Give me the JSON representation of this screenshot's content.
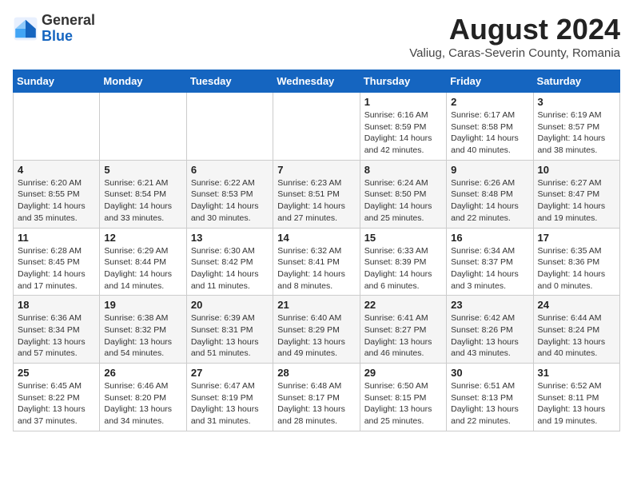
{
  "header": {
    "logo_general": "General",
    "logo_blue": "Blue",
    "title": "August 2024",
    "subtitle": "Valiug, Caras-Severin County, Romania"
  },
  "weekdays": [
    "Sunday",
    "Monday",
    "Tuesday",
    "Wednesday",
    "Thursday",
    "Friday",
    "Saturday"
  ],
  "weeks": [
    [
      {
        "day": "",
        "info": ""
      },
      {
        "day": "",
        "info": ""
      },
      {
        "day": "",
        "info": ""
      },
      {
        "day": "",
        "info": ""
      },
      {
        "day": "1",
        "info": "Sunrise: 6:16 AM\nSunset: 8:59 PM\nDaylight: 14 hours and 42 minutes."
      },
      {
        "day": "2",
        "info": "Sunrise: 6:17 AM\nSunset: 8:58 PM\nDaylight: 14 hours and 40 minutes."
      },
      {
        "day": "3",
        "info": "Sunrise: 6:19 AM\nSunset: 8:57 PM\nDaylight: 14 hours and 38 minutes."
      }
    ],
    [
      {
        "day": "4",
        "info": "Sunrise: 6:20 AM\nSunset: 8:55 PM\nDaylight: 14 hours and 35 minutes."
      },
      {
        "day": "5",
        "info": "Sunrise: 6:21 AM\nSunset: 8:54 PM\nDaylight: 14 hours and 33 minutes."
      },
      {
        "day": "6",
        "info": "Sunrise: 6:22 AM\nSunset: 8:53 PM\nDaylight: 14 hours and 30 minutes."
      },
      {
        "day": "7",
        "info": "Sunrise: 6:23 AM\nSunset: 8:51 PM\nDaylight: 14 hours and 27 minutes."
      },
      {
        "day": "8",
        "info": "Sunrise: 6:24 AM\nSunset: 8:50 PM\nDaylight: 14 hours and 25 minutes."
      },
      {
        "day": "9",
        "info": "Sunrise: 6:26 AM\nSunset: 8:48 PM\nDaylight: 14 hours and 22 minutes."
      },
      {
        "day": "10",
        "info": "Sunrise: 6:27 AM\nSunset: 8:47 PM\nDaylight: 14 hours and 19 minutes."
      }
    ],
    [
      {
        "day": "11",
        "info": "Sunrise: 6:28 AM\nSunset: 8:45 PM\nDaylight: 14 hours and 17 minutes."
      },
      {
        "day": "12",
        "info": "Sunrise: 6:29 AM\nSunset: 8:44 PM\nDaylight: 14 hours and 14 minutes."
      },
      {
        "day": "13",
        "info": "Sunrise: 6:30 AM\nSunset: 8:42 PM\nDaylight: 14 hours and 11 minutes."
      },
      {
        "day": "14",
        "info": "Sunrise: 6:32 AM\nSunset: 8:41 PM\nDaylight: 14 hours and 8 minutes."
      },
      {
        "day": "15",
        "info": "Sunrise: 6:33 AM\nSunset: 8:39 PM\nDaylight: 14 hours and 6 minutes."
      },
      {
        "day": "16",
        "info": "Sunrise: 6:34 AM\nSunset: 8:37 PM\nDaylight: 14 hours and 3 minutes."
      },
      {
        "day": "17",
        "info": "Sunrise: 6:35 AM\nSunset: 8:36 PM\nDaylight: 14 hours and 0 minutes."
      }
    ],
    [
      {
        "day": "18",
        "info": "Sunrise: 6:36 AM\nSunset: 8:34 PM\nDaylight: 13 hours and 57 minutes."
      },
      {
        "day": "19",
        "info": "Sunrise: 6:38 AM\nSunset: 8:32 PM\nDaylight: 13 hours and 54 minutes."
      },
      {
        "day": "20",
        "info": "Sunrise: 6:39 AM\nSunset: 8:31 PM\nDaylight: 13 hours and 51 minutes."
      },
      {
        "day": "21",
        "info": "Sunrise: 6:40 AM\nSunset: 8:29 PM\nDaylight: 13 hours and 49 minutes."
      },
      {
        "day": "22",
        "info": "Sunrise: 6:41 AM\nSunset: 8:27 PM\nDaylight: 13 hours and 46 minutes."
      },
      {
        "day": "23",
        "info": "Sunrise: 6:42 AM\nSunset: 8:26 PM\nDaylight: 13 hours and 43 minutes."
      },
      {
        "day": "24",
        "info": "Sunrise: 6:44 AM\nSunset: 8:24 PM\nDaylight: 13 hours and 40 minutes."
      }
    ],
    [
      {
        "day": "25",
        "info": "Sunrise: 6:45 AM\nSunset: 8:22 PM\nDaylight: 13 hours and 37 minutes."
      },
      {
        "day": "26",
        "info": "Sunrise: 6:46 AM\nSunset: 8:20 PM\nDaylight: 13 hours and 34 minutes."
      },
      {
        "day": "27",
        "info": "Sunrise: 6:47 AM\nSunset: 8:19 PM\nDaylight: 13 hours and 31 minutes."
      },
      {
        "day": "28",
        "info": "Sunrise: 6:48 AM\nSunset: 8:17 PM\nDaylight: 13 hours and 28 minutes."
      },
      {
        "day": "29",
        "info": "Sunrise: 6:50 AM\nSunset: 8:15 PM\nDaylight: 13 hours and 25 minutes."
      },
      {
        "day": "30",
        "info": "Sunrise: 6:51 AM\nSunset: 8:13 PM\nDaylight: 13 hours and 22 minutes."
      },
      {
        "day": "31",
        "info": "Sunrise: 6:52 AM\nSunset: 8:11 PM\nDaylight: 13 hours and 19 minutes."
      }
    ]
  ]
}
